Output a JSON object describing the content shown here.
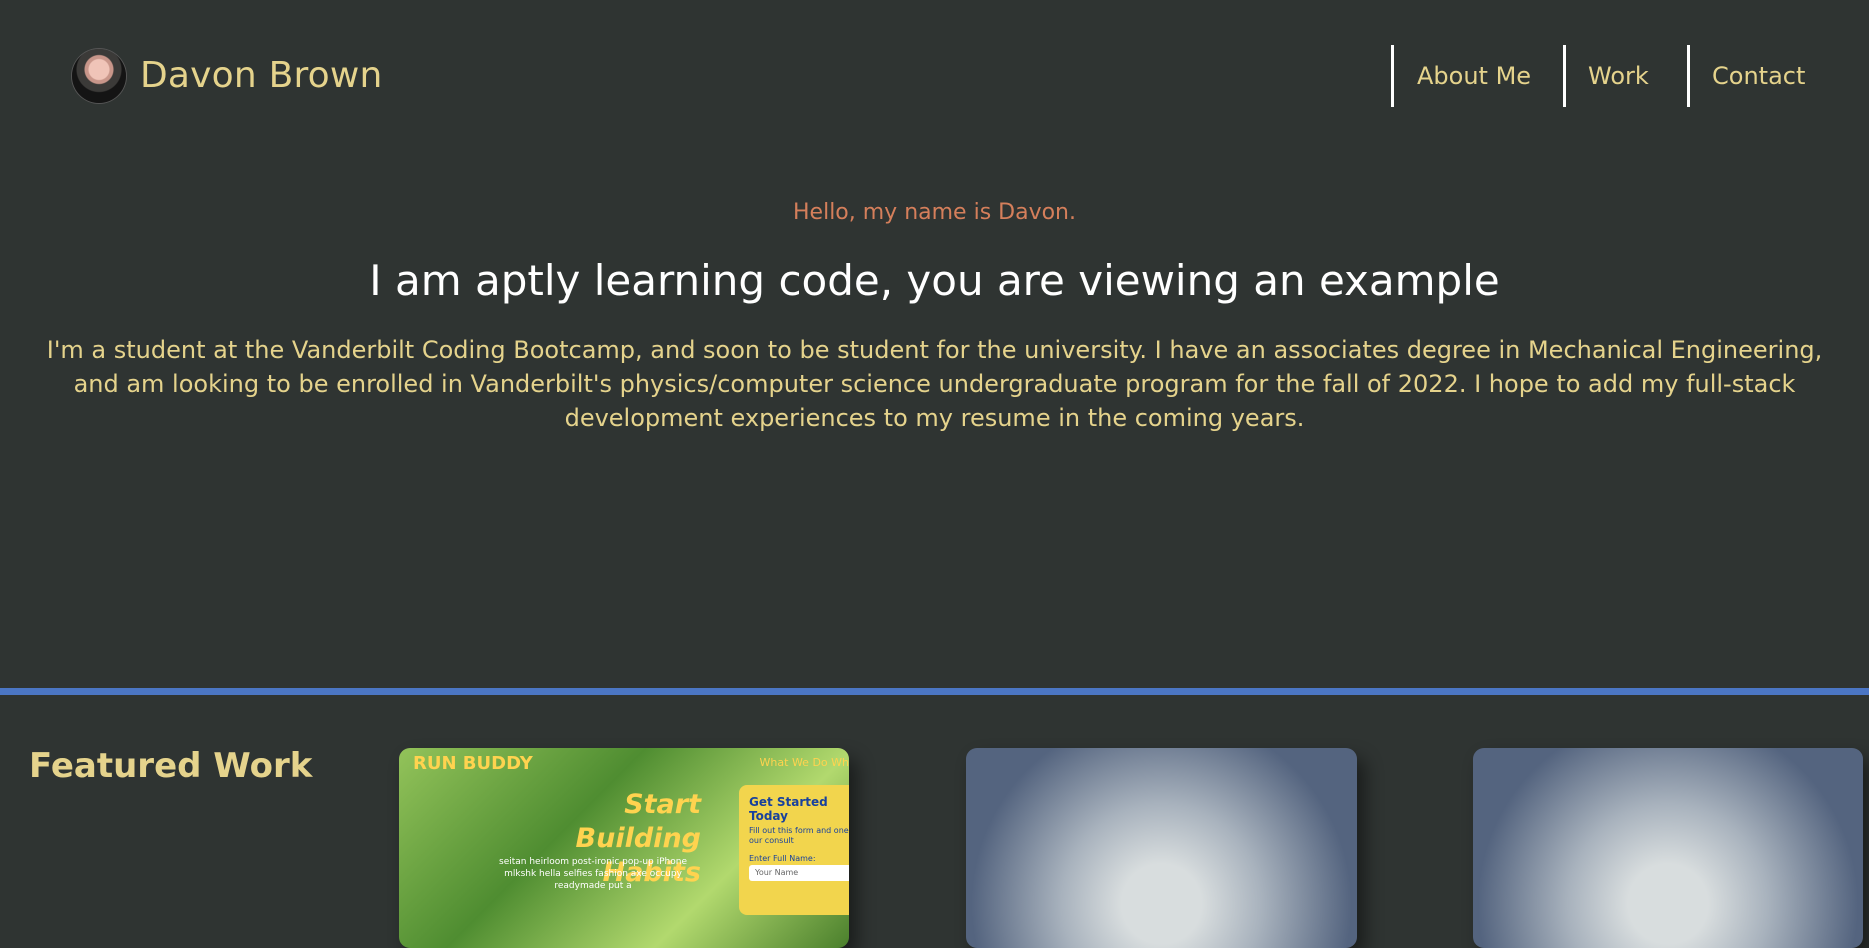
{
  "header": {
    "name": "Davon Brown",
    "avatar_alt": "profile photo",
    "nav": [
      {
        "label": "About Me"
      },
      {
        "label": "Work"
      },
      {
        "label": "Contact"
      }
    ]
  },
  "hero": {
    "greeting": "Hello, my name is Davon.",
    "headline": "I am aptly learning code, you are viewing an example",
    "intro": "I'm a student at the Vanderbilt Coding Bootcamp, and soon to be student for the university. I have an associates degree in Mechanical Engineering, and am looking to be enrolled in Vanderbilt's physics/computer science undergraduate program for the fall of 2022. I hope to add my full-stack development experiences to my resume in the coming years."
  },
  "work": {
    "title": "Featured Work",
    "cards": [
      {
        "logo": "RUN BUDDY",
        "nav": "What We Do   Wh",
        "headline_line1": "Start Building",
        "headline_line2": "Habits",
        "body": "seitan heirloom post-ironic pop-up iPhone mlkshk hella selfies fashion axe occupy readymade put a",
        "form_title": "Get Started Today",
        "form_subtitle": "Fill out this form and one of our consult",
        "form_label": "Enter Full Name:",
        "form_placeholder": "Your Name"
      },
      {},
      {}
    ]
  },
  "colors": {
    "background": "#2f3432",
    "accent_yellow": "#e5d38c",
    "greeting_orange": "#d57f5b",
    "divider_blue": "#4b76c4"
  }
}
